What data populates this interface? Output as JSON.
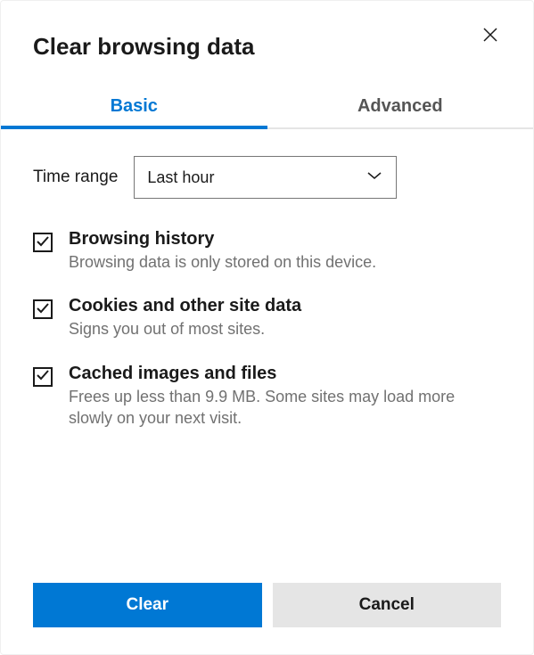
{
  "header": {
    "title": "Clear browsing data"
  },
  "tabs": {
    "basic": "Basic",
    "advanced": "Advanced"
  },
  "time_range": {
    "label": "Time range",
    "selected": "Last hour"
  },
  "options": [
    {
      "title": "Browsing history",
      "desc": "Browsing data is only stored on this device.",
      "checked": true
    },
    {
      "title": "Cookies and other site data",
      "desc": "Signs you out of most sites.",
      "checked": true
    },
    {
      "title": "Cached images and files",
      "desc": "Frees up less than 9.9 MB. Some sites may load more slowly on your next visit.",
      "checked": true
    }
  ],
  "buttons": {
    "clear": "Clear",
    "cancel": "Cancel"
  }
}
